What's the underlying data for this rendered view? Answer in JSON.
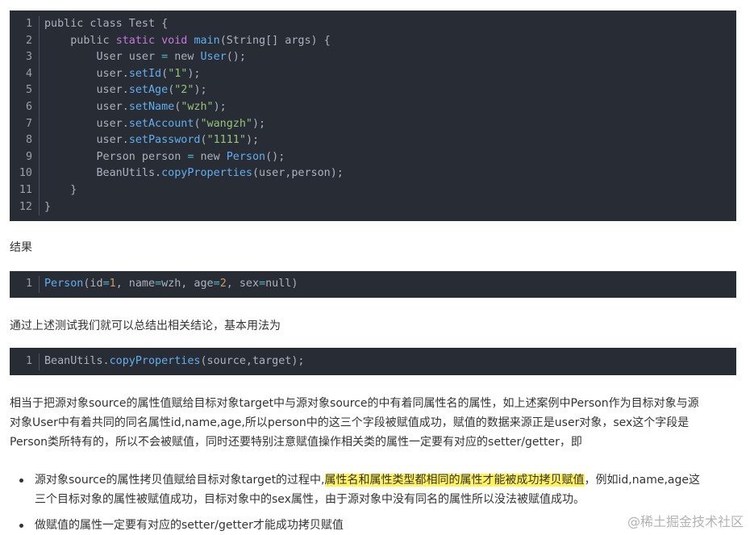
{
  "code1": [
    {
      "n": "1",
      "tokens": [
        {
          "t": "public class Test {",
          "c": "p"
        }
      ]
    },
    {
      "n": "2",
      "tokens": [
        {
          "t": "    public ",
          "c": "p"
        },
        {
          "t": "static void ",
          "c": "k"
        },
        {
          "t": "main",
          "c": "f"
        },
        {
          "t": "(String[] args) {",
          "c": "p"
        }
      ]
    },
    {
      "n": "3",
      "tokens": [
        {
          "t": "        User user ",
          "c": "p"
        },
        {
          "t": "=",
          "c": "o"
        },
        {
          "t": " new ",
          "c": "p"
        },
        {
          "t": "User",
          "c": "f"
        },
        {
          "t": "();",
          "c": "p"
        }
      ]
    },
    {
      "n": "4",
      "tokens": [
        {
          "t": "        user.",
          "c": "p"
        },
        {
          "t": "setId",
          "c": "f"
        },
        {
          "t": "(",
          "c": "p"
        },
        {
          "t": "\"1\"",
          "c": "s"
        },
        {
          "t": ");",
          "c": "p"
        }
      ]
    },
    {
      "n": "5",
      "tokens": [
        {
          "t": "        user.",
          "c": "p"
        },
        {
          "t": "setAge",
          "c": "f"
        },
        {
          "t": "(",
          "c": "p"
        },
        {
          "t": "\"2\"",
          "c": "s"
        },
        {
          "t": ");",
          "c": "p"
        }
      ]
    },
    {
      "n": "6",
      "tokens": [
        {
          "t": "        user.",
          "c": "p"
        },
        {
          "t": "setName",
          "c": "f"
        },
        {
          "t": "(",
          "c": "p"
        },
        {
          "t": "\"wzh\"",
          "c": "s"
        },
        {
          "t": ");",
          "c": "p"
        }
      ]
    },
    {
      "n": "7",
      "tokens": [
        {
          "t": "        user.",
          "c": "p"
        },
        {
          "t": "setAccount",
          "c": "f"
        },
        {
          "t": "(",
          "c": "p"
        },
        {
          "t": "\"wangzh\"",
          "c": "s"
        },
        {
          "t": ");",
          "c": "p"
        }
      ]
    },
    {
      "n": "8",
      "tokens": [
        {
          "t": "        user.",
          "c": "p"
        },
        {
          "t": "setPassword",
          "c": "f"
        },
        {
          "t": "(",
          "c": "p"
        },
        {
          "t": "\"1111\"",
          "c": "s"
        },
        {
          "t": ");",
          "c": "p"
        }
      ]
    },
    {
      "n": "9",
      "tokens": [
        {
          "t": "        Person person ",
          "c": "p"
        },
        {
          "t": "=",
          "c": "o"
        },
        {
          "t": " new ",
          "c": "p"
        },
        {
          "t": "Person",
          "c": "f"
        },
        {
          "t": "();",
          "c": "p"
        }
      ]
    },
    {
      "n": "10",
      "tokens": [
        {
          "t": "        BeanUtils.",
          "c": "p"
        },
        {
          "t": "copyProperties",
          "c": "f"
        },
        {
          "t": "(user,person);",
          "c": "p"
        }
      ]
    },
    {
      "n": "11",
      "tokens": [
        {
          "t": "    }",
          "c": "p"
        }
      ]
    },
    {
      "n": "12",
      "tokens": [
        {
          "t": "}",
          "c": "p"
        }
      ]
    }
  ],
  "result_label": "结果",
  "code2": [
    {
      "n": "1",
      "tokens": [
        {
          "t": "Person",
          "c": "f"
        },
        {
          "t": "(id",
          "c": "p"
        },
        {
          "t": "=",
          "c": "o"
        },
        {
          "t": "1",
          "c": "n"
        },
        {
          "t": ", name",
          "c": "p"
        },
        {
          "t": "=",
          "c": "o"
        },
        {
          "t": "wzh, age",
          "c": "p"
        },
        {
          "t": "=",
          "c": "o"
        },
        {
          "t": "2",
          "c": "n"
        },
        {
          "t": ", sex",
          "c": "p"
        },
        {
          "t": "=",
          "c": "o"
        },
        {
          "t": "null)",
          "c": "p"
        }
      ]
    }
  ],
  "conclusion_intro": "通过上述测试我们就可以总结出相关结论，基本用法为",
  "code3": [
    {
      "n": "1",
      "tokens": [
        {
          "t": "BeanUtils.",
          "c": "p"
        },
        {
          "t": "copyProperties",
          "c": "f"
        },
        {
          "t": "(source,target);",
          "c": "p"
        }
      ]
    }
  ],
  "para_lines": [
    "相当于把源对象source的属性值赋给目标对象target中与源对象source的中有着同属性名的属性，如上述案例中Person作为目标对象与源",
    "对象User中有着共同的同名属性id,name,age,所以person中的这三个字段被赋值成功，赋值的数据来源正是user对象，sex这个字段是",
    "Person类所特有的，所以不会被赋值，同时还要特别注意赋值操作相关类的属性一定要有对应的setter/getter，即"
  ],
  "bullets": {
    "b1_prefix": "源对象source的属性拷贝值赋给目标对象target的过程中,",
    "b1_highlight": "属性名和属性类型都相同的属性才能被成功拷贝赋值",
    "b1_suffix": "，例如id,name,age这",
    "b1_line2": "三个目标对象的属性被赋值成功，目标对象中的sex属性，由于源对象中没有同名的属性所以没法被赋值成功。",
    "b2": "做赋值的属性一定要有对应的setter/getter才能成功拷贝赋值"
  },
  "watermark": "@稀土掘金技术社区",
  "colors": {
    "code_bg": "#282c34",
    "highlight": "#fff25e",
    "function": "#61afef",
    "string": "#98c379",
    "keyword": "#c678dd"
  }
}
